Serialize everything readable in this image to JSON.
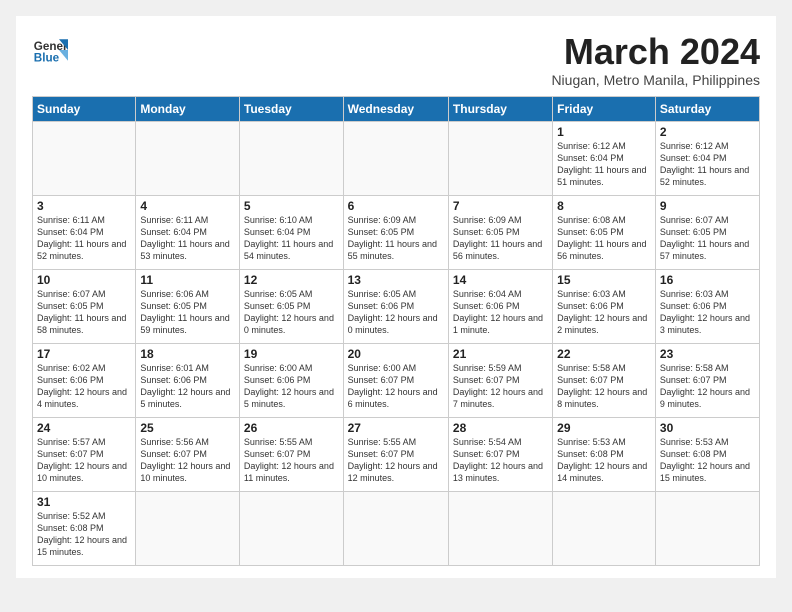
{
  "logo": {
    "text_general": "General",
    "text_blue": "Blue"
  },
  "header": {
    "month_year": "March 2024",
    "location": "Niugan, Metro Manila, Philippines"
  },
  "days_of_week": [
    "Sunday",
    "Monday",
    "Tuesday",
    "Wednesday",
    "Thursday",
    "Friday",
    "Saturday"
  ],
  "weeks": [
    [
      {
        "day": "",
        "info": ""
      },
      {
        "day": "",
        "info": ""
      },
      {
        "day": "",
        "info": ""
      },
      {
        "day": "",
        "info": ""
      },
      {
        "day": "",
        "info": ""
      },
      {
        "day": "1",
        "info": "Sunrise: 6:12 AM\nSunset: 6:04 PM\nDaylight: 11 hours\nand 51 minutes."
      },
      {
        "day": "2",
        "info": "Sunrise: 6:12 AM\nSunset: 6:04 PM\nDaylight: 11 hours\nand 52 minutes."
      }
    ],
    [
      {
        "day": "3",
        "info": "Sunrise: 6:11 AM\nSunset: 6:04 PM\nDaylight: 11 hours\nand 52 minutes."
      },
      {
        "day": "4",
        "info": "Sunrise: 6:11 AM\nSunset: 6:04 PM\nDaylight: 11 hours\nand 53 minutes."
      },
      {
        "day": "5",
        "info": "Sunrise: 6:10 AM\nSunset: 6:04 PM\nDaylight: 11 hours\nand 54 minutes."
      },
      {
        "day": "6",
        "info": "Sunrise: 6:09 AM\nSunset: 6:05 PM\nDaylight: 11 hours\nand 55 minutes."
      },
      {
        "day": "7",
        "info": "Sunrise: 6:09 AM\nSunset: 6:05 PM\nDaylight: 11 hours\nand 56 minutes."
      },
      {
        "day": "8",
        "info": "Sunrise: 6:08 AM\nSunset: 6:05 PM\nDaylight: 11 hours\nand 56 minutes."
      },
      {
        "day": "9",
        "info": "Sunrise: 6:07 AM\nSunset: 6:05 PM\nDaylight: 11 hours\nand 57 minutes."
      }
    ],
    [
      {
        "day": "10",
        "info": "Sunrise: 6:07 AM\nSunset: 6:05 PM\nDaylight: 11 hours\nand 58 minutes."
      },
      {
        "day": "11",
        "info": "Sunrise: 6:06 AM\nSunset: 6:05 PM\nDaylight: 11 hours\nand 59 minutes."
      },
      {
        "day": "12",
        "info": "Sunrise: 6:05 AM\nSunset: 6:05 PM\nDaylight: 12 hours\nand 0 minutes."
      },
      {
        "day": "13",
        "info": "Sunrise: 6:05 AM\nSunset: 6:06 PM\nDaylight: 12 hours\nand 0 minutes."
      },
      {
        "day": "14",
        "info": "Sunrise: 6:04 AM\nSunset: 6:06 PM\nDaylight: 12 hours\nand 1 minute."
      },
      {
        "day": "15",
        "info": "Sunrise: 6:03 AM\nSunset: 6:06 PM\nDaylight: 12 hours\nand 2 minutes."
      },
      {
        "day": "16",
        "info": "Sunrise: 6:03 AM\nSunset: 6:06 PM\nDaylight: 12 hours\nand 3 minutes."
      }
    ],
    [
      {
        "day": "17",
        "info": "Sunrise: 6:02 AM\nSunset: 6:06 PM\nDaylight: 12 hours\nand 4 minutes."
      },
      {
        "day": "18",
        "info": "Sunrise: 6:01 AM\nSunset: 6:06 PM\nDaylight: 12 hours\nand 5 minutes."
      },
      {
        "day": "19",
        "info": "Sunrise: 6:00 AM\nSunset: 6:06 PM\nDaylight: 12 hours\nand 5 minutes."
      },
      {
        "day": "20",
        "info": "Sunrise: 6:00 AM\nSunset: 6:07 PM\nDaylight: 12 hours\nand 6 minutes."
      },
      {
        "day": "21",
        "info": "Sunrise: 5:59 AM\nSunset: 6:07 PM\nDaylight: 12 hours\nand 7 minutes."
      },
      {
        "day": "22",
        "info": "Sunrise: 5:58 AM\nSunset: 6:07 PM\nDaylight: 12 hours\nand 8 minutes."
      },
      {
        "day": "23",
        "info": "Sunrise: 5:58 AM\nSunset: 6:07 PM\nDaylight: 12 hours\nand 9 minutes."
      }
    ],
    [
      {
        "day": "24",
        "info": "Sunrise: 5:57 AM\nSunset: 6:07 PM\nDaylight: 12 hours\nand 10 minutes."
      },
      {
        "day": "25",
        "info": "Sunrise: 5:56 AM\nSunset: 6:07 PM\nDaylight: 12 hours\nand 10 minutes."
      },
      {
        "day": "26",
        "info": "Sunrise: 5:55 AM\nSunset: 6:07 PM\nDaylight: 12 hours\nand 11 minutes."
      },
      {
        "day": "27",
        "info": "Sunrise: 5:55 AM\nSunset: 6:07 PM\nDaylight: 12 hours\nand 12 minutes."
      },
      {
        "day": "28",
        "info": "Sunrise: 5:54 AM\nSunset: 6:07 PM\nDaylight: 12 hours\nand 13 minutes."
      },
      {
        "day": "29",
        "info": "Sunrise: 5:53 AM\nSunset: 6:08 PM\nDaylight: 12 hours\nand 14 minutes."
      },
      {
        "day": "30",
        "info": "Sunrise: 5:53 AM\nSunset: 6:08 PM\nDaylight: 12 hours\nand 15 minutes."
      }
    ],
    [
      {
        "day": "31",
        "info": "Sunrise: 5:52 AM\nSunset: 6:08 PM\nDaylight: 12 hours\nand 15 minutes."
      },
      {
        "day": "",
        "info": ""
      },
      {
        "day": "",
        "info": ""
      },
      {
        "day": "",
        "info": ""
      },
      {
        "day": "",
        "info": ""
      },
      {
        "day": "",
        "info": ""
      },
      {
        "day": "",
        "info": ""
      }
    ]
  ]
}
